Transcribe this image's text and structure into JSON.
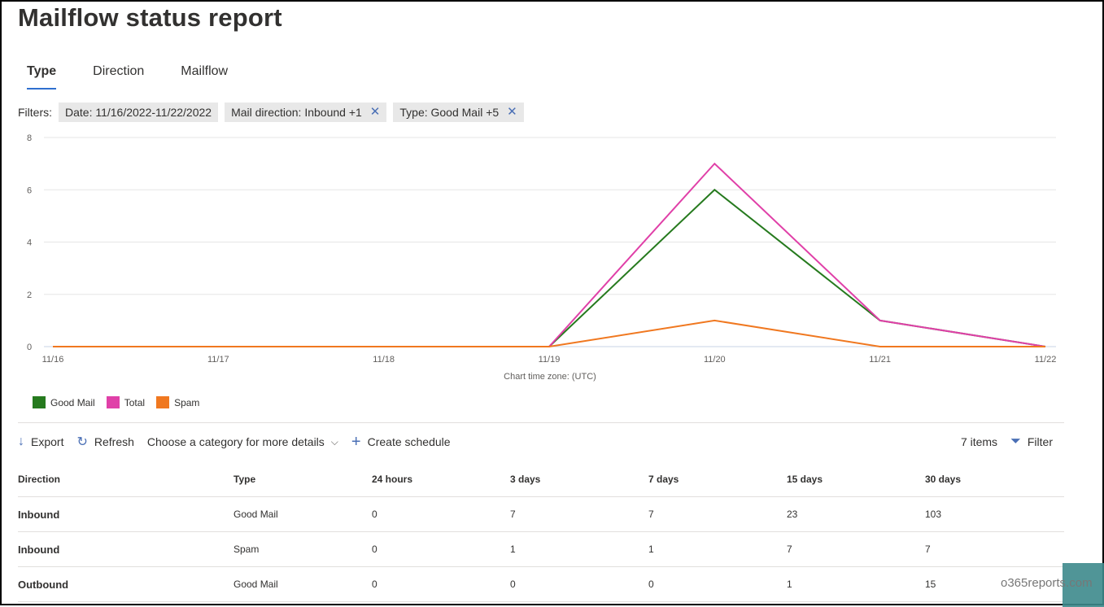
{
  "page": {
    "title": "Mailflow status report"
  },
  "tabs": [
    {
      "label": "Type",
      "active": true
    },
    {
      "label": "Direction",
      "active": false
    },
    {
      "label": "Mailflow",
      "active": false
    }
  ],
  "filters": {
    "label": "Filters:",
    "chips": [
      {
        "label": "Date: 11/16/2022-11/22/2022",
        "removable": false
      },
      {
        "label": "Mail direction: Inbound +1",
        "removable": true
      },
      {
        "label": "Type: Good Mail +5",
        "removable": true
      }
    ]
  },
  "chart_data": {
    "type": "line",
    "title": "",
    "xlabel": "Chart time zone: (UTC)",
    "ylabel": "",
    "x": [
      "11/16",
      "11/17",
      "11/18",
      "11/19",
      "11/20",
      "11/21",
      "11/22"
    ],
    "yticks": [
      0,
      2,
      4,
      6,
      8
    ],
    "ylim": [
      0,
      8
    ],
    "grid": true,
    "legend_position": "bottom-left",
    "series": [
      {
        "name": "Good Mail",
        "color": "#267a1e",
        "values": [
          0,
          0,
          0,
          0,
          6,
          1,
          0
        ]
      },
      {
        "name": "Total",
        "color": "#e040a8",
        "values": [
          0,
          0,
          0,
          0,
          7,
          1,
          0
        ]
      },
      {
        "name": "Spam",
        "color": "#f07820",
        "values": [
          0,
          0,
          0,
          0,
          1,
          0,
          0
        ]
      }
    ]
  },
  "toolbar": {
    "export": "Export",
    "refresh": "Refresh",
    "category": "Choose a category for more details",
    "schedule": "Create schedule",
    "items": "7 items",
    "filter": "Filter"
  },
  "table": {
    "columns": [
      "Direction",
      "Type",
      "24 hours",
      "3 days",
      "7 days",
      "15 days",
      "30 days"
    ],
    "rows": [
      [
        "Inbound",
        "Good Mail",
        "0",
        "7",
        "7",
        "23",
        "103"
      ],
      [
        "Inbound",
        "Spam",
        "0",
        "1",
        "1",
        "7",
        "7"
      ],
      [
        "Outbound",
        "Good Mail",
        "0",
        "0",
        "0",
        "1",
        "15"
      ]
    ]
  },
  "watermark": "o365reports.com"
}
